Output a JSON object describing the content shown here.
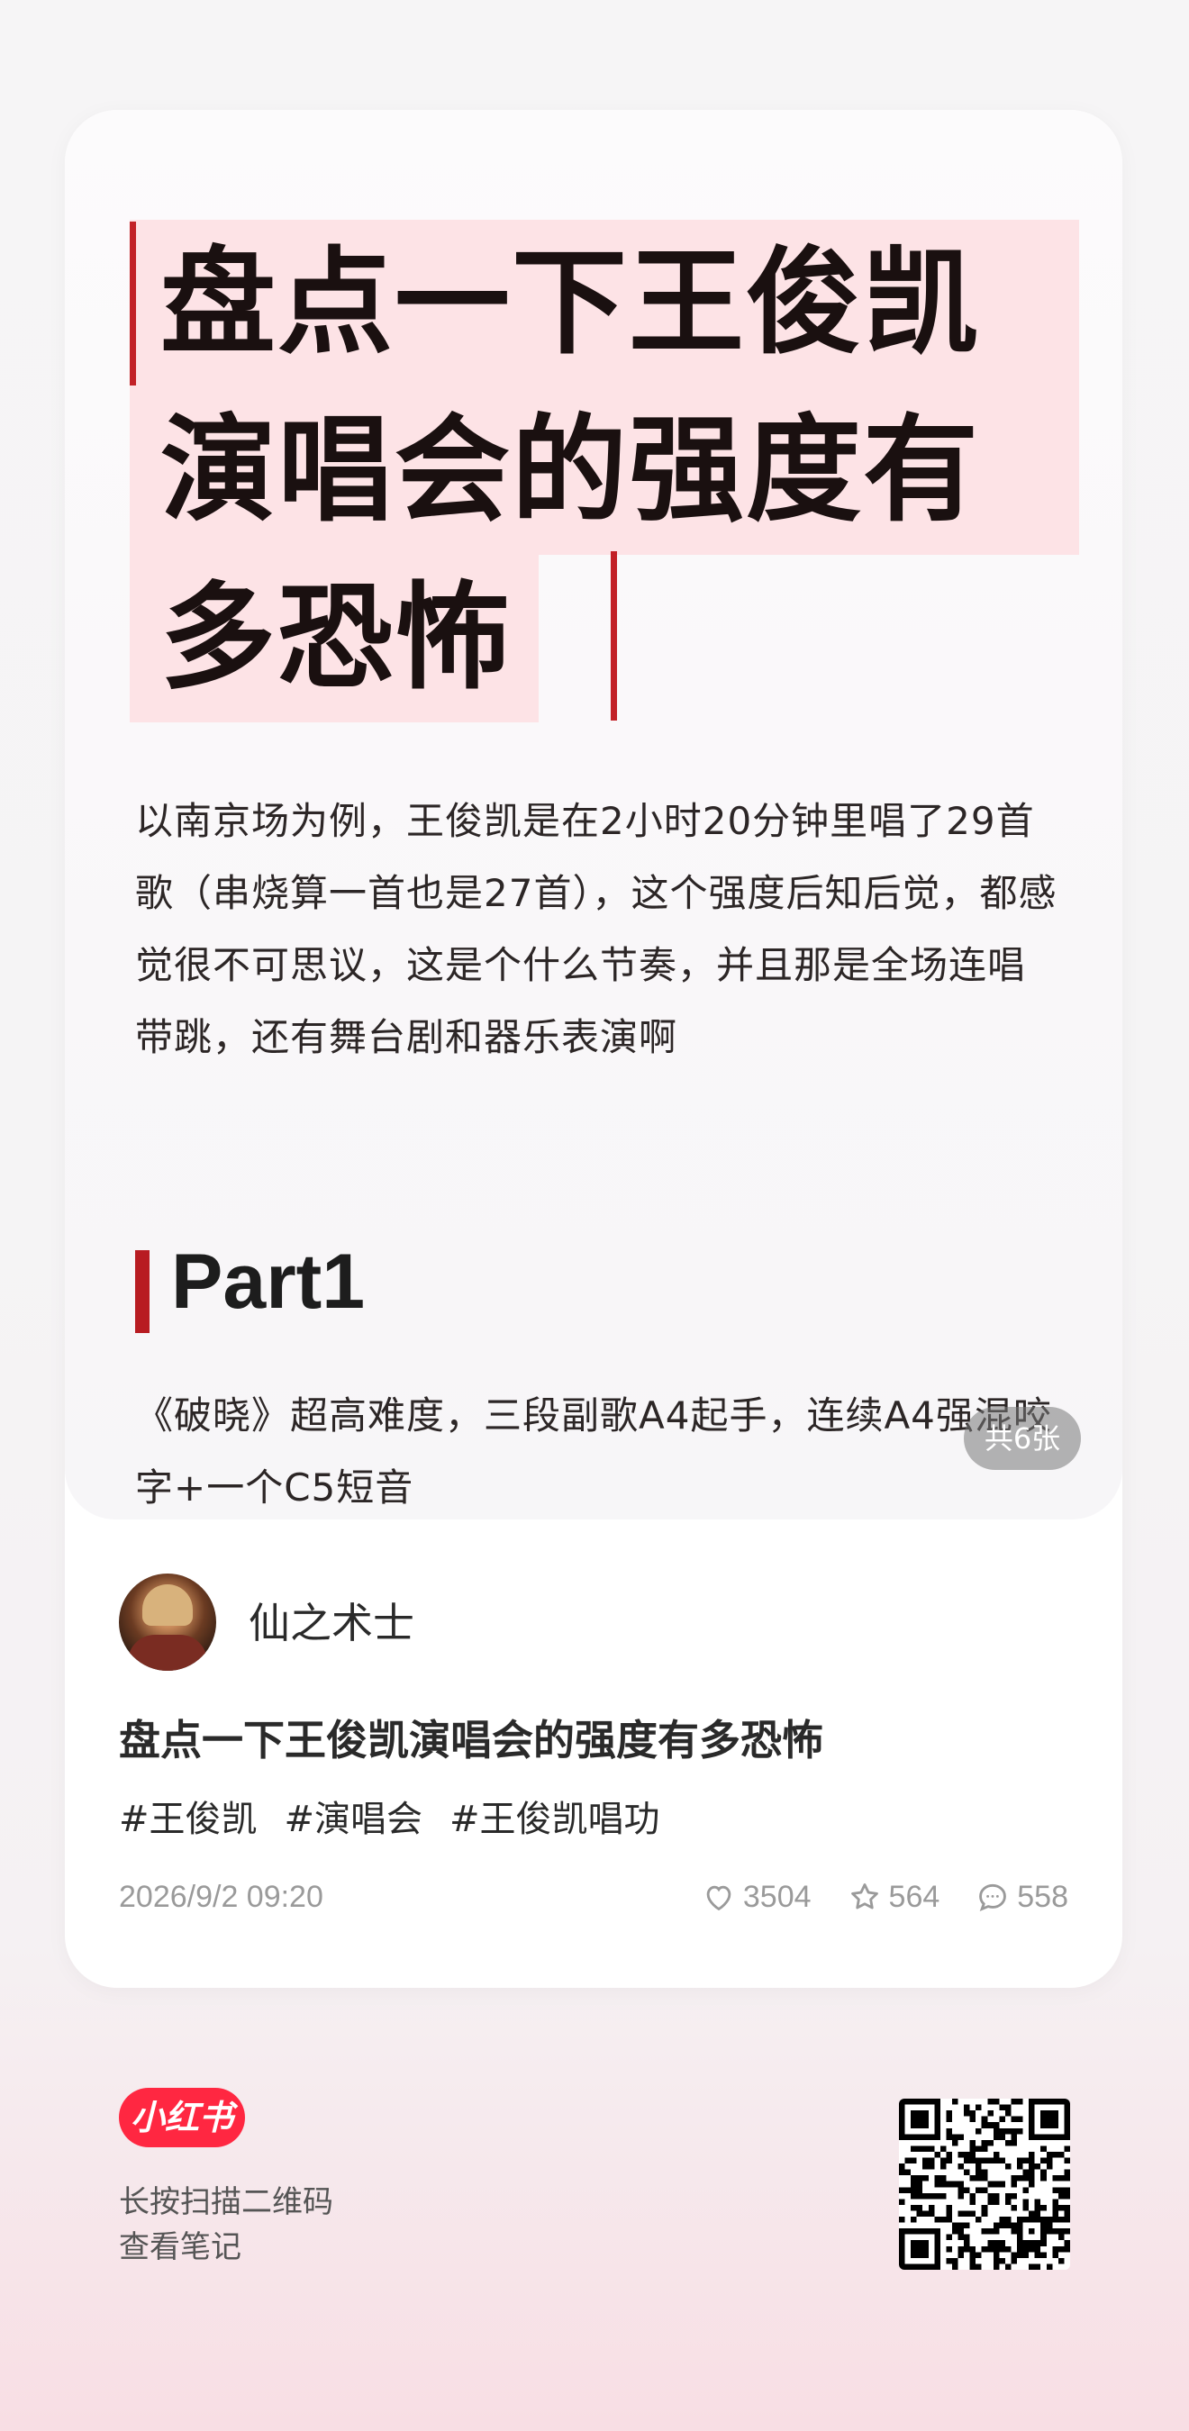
{
  "cover": {
    "title_lines": [
      "盘点一下王俊凯",
      "演唱会的强度有",
      "多恐怖"
    ],
    "paragraph": "以南京场为例，王俊凯是在2小时20分钟里唱了29首歌（串烧算一首也是27首），这个强度后知后觉，都感觉很不可思议，这是个什么节奏，并且那是全场连唱带跳，还有舞台剧和器乐表演啊",
    "part_title": "Part1",
    "part_paragraph": "《破晓》超高难度，三段副歌A4起手，连续A4强混咬字+一个C5短音",
    "image_count": "共6张"
  },
  "post": {
    "author": "仙之术士",
    "title": "盘点一下王俊凯演唱会的强度有多恐怖",
    "tags": [
      "#王俊凯",
      "#演唱会",
      "#王俊凯唱功"
    ],
    "date": "2026/9/2 09:20",
    "likes": "3504",
    "favorites": "564",
    "comments": "558"
  },
  "footer": {
    "logo_text": "小红书",
    "hint_line1": "长按扫描二维码",
    "hint_line2": "查看笔记"
  },
  "colors": {
    "brand_red": "#ff2741",
    "title_highlight": "#fde3e6",
    "accent_bar": "#c22127"
  }
}
